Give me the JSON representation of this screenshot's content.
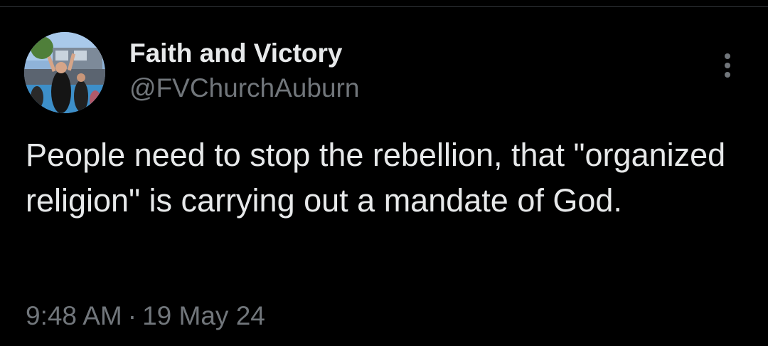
{
  "tweet": {
    "author": {
      "display_name": "Faith and Victory",
      "handle": "@FVChurchAuburn"
    },
    "text": "People need to stop the rebellion, that \"organized religion\" is carrying out a mandate of God.",
    "time": "9:48 AM",
    "separator": "·",
    "date": "19 May 24",
    "more_icon": "more-vertical-icon"
  },
  "colors": {
    "background": "#000000",
    "primary_text": "#e7e9ea",
    "secondary_text": "#71767b",
    "divider": "#2f3336"
  }
}
